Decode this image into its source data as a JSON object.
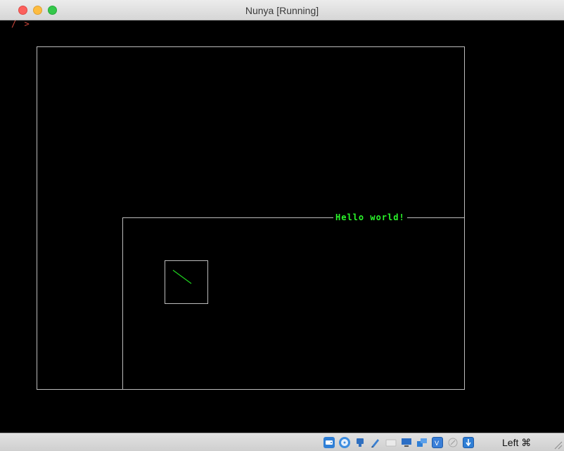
{
  "window": {
    "title": "Nunya [Running]"
  },
  "screen": {
    "cursor_glyph": "/ >",
    "message": "Hello world!",
    "colors": {
      "background": "#000000",
      "frame": "#bcbcbc",
      "text": "#2af52a",
      "line": "#1fd61f"
    }
  },
  "statusbar": {
    "icons": [
      "hard-disk-icon",
      "optical-disk-icon",
      "usb-icon",
      "shared-folders-icon",
      "display-icon",
      "network-icon",
      "screen-capture-icon",
      "cpu-icon",
      "mouse-integration-icon",
      "keyboard-capture-icon"
    ],
    "host_key": "Left ⌘"
  }
}
